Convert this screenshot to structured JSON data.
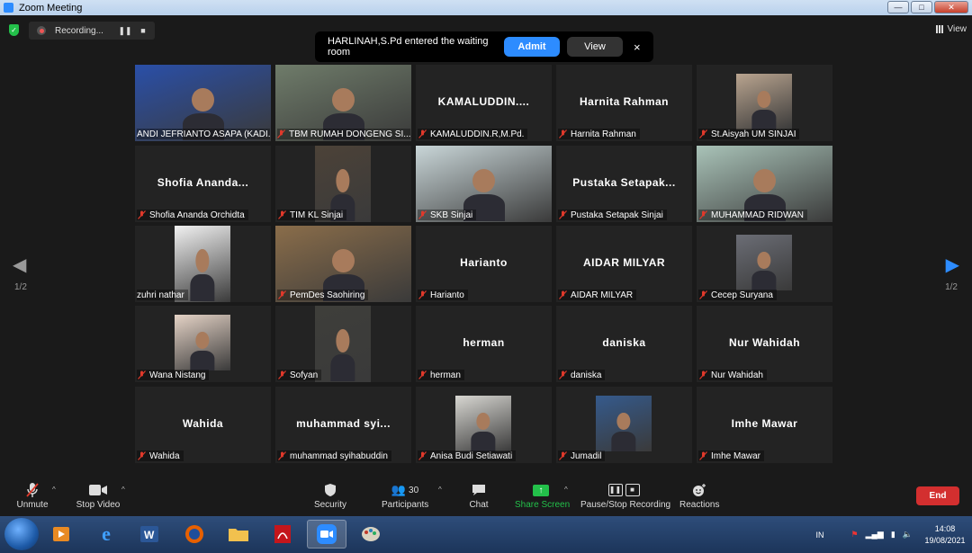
{
  "window": {
    "title": "Zoom Meeting",
    "min": "—",
    "max": "□",
    "close": "✕"
  },
  "recording": {
    "label": "Recording...",
    "pause": "❚❚",
    "stop": "■"
  },
  "view_button": "View",
  "waiting_room": {
    "message": "HARLINAH,S.Pd entered the waiting room",
    "admit": "Admit",
    "view": "View",
    "close": "×"
  },
  "pagination": {
    "left": "1/2",
    "right": "1/2",
    "prev": "◀",
    "next": "▶"
  },
  "participants": [
    {
      "name": "ANDI JEFRIANTO ASAPA (KADI...",
      "big": "",
      "muted": false,
      "video": true,
      "active": true
    },
    {
      "name": "TBM RUMAH DONGENG SI...",
      "big": "",
      "muted": true,
      "video": true
    },
    {
      "name": "KAMALUDDIN.R,M.Pd.",
      "big": "KAMALUDDIN....",
      "muted": true,
      "video": false
    },
    {
      "name": "Harnita Rahman",
      "big": "Harnita Rahman",
      "muted": true,
      "video": false
    },
    {
      "name": "St.Aisyah UM SINJAI",
      "big": "",
      "muted": true,
      "video": true
    },
    {
      "name": "Shofia Ananda Orchidta",
      "big": "Shofia  Ananda...",
      "muted": true,
      "video": false
    },
    {
      "name": "TIM KL Sinjai",
      "big": "",
      "muted": true,
      "video": true
    },
    {
      "name": "SKB Sinjai",
      "big": "",
      "muted": true,
      "video": true
    },
    {
      "name": "Pustaka Setapak Sinjai",
      "big": "Pustaka  Setapak...",
      "muted": true,
      "video": false
    },
    {
      "name": "MUHAMMAD RIDWAN",
      "big": "",
      "muted": true,
      "video": true
    },
    {
      "name": "zuhri nathar",
      "big": "",
      "muted": false,
      "video": true
    },
    {
      "name": "PemDes Saohiring",
      "big": "",
      "muted": true,
      "video": true
    },
    {
      "name": "Harianto",
      "big": "Harianto",
      "muted": true,
      "video": false
    },
    {
      "name": "AIDAR MILYAR",
      "big": "AIDAR MILYAR",
      "muted": true,
      "video": false
    },
    {
      "name": "Cecep Suryana",
      "big": "",
      "muted": true,
      "video": true
    },
    {
      "name": "Wana Nistang",
      "big": "",
      "muted": true,
      "video": true
    },
    {
      "name": "Sofyan",
      "big": "",
      "muted": true,
      "video": true
    },
    {
      "name": "herman",
      "big": "herman",
      "muted": true,
      "video": false
    },
    {
      "name": "daniska",
      "big": "daniska",
      "muted": true,
      "video": false
    },
    {
      "name": "Nur Wahidah",
      "big": "Nur Wahidah",
      "muted": true,
      "video": false
    },
    {
      "name": "Wahida",
      "big": "Wahida",
      "muted": true,
      "video": false
    },
    {
      "name": "muhammad syihabuddin",
      "big": "muhammad  syi...",
      "muted": true,
      "video": false
    },
    {
      "name": "Anisa Budi Setiawati",
      "big": "",
      "muted": true,
      "video": true
    },
    {
      "name": "Jumadil",
      "big": "",
      "muted": true,
      "video": true
    },
    {
      "name": "Imhe Mawar",
      "big": "Imhe Mawar",
      "muted": true,
      "video": false
    }
  ],
  "toolbar": {
    "unmute": "Unmute",
    "stop_video": "Stop Video",
    "security": "Security",
    "participants": "Participants",
    "participants_count": "30",
    "chat": "Chat",
    "share_screen": "Share Screen",
    "recording": "Pause/Stop Recording",
    "reactions": "Reactions",
    "end": "End"
  },
  "taskbar": {
    "apps": [
      "media-player-icon",
      "internet-explorer-icon",
      "word-icon",
      "firefox-icon",
      "file-explorer-icon",
      "acrobat-icon",
      "zoom-icon",
      "paint-icon"
    ],
    "language": "IN",
    "time": "14:08",
    "date": "19/08/2021"
  },
  "colors": {
    "accent": "#2d8cff",
    "end": "#d32f2f",
    "share": "#23c04a",
    "active_speaker": "#e8e352"
  }
}
